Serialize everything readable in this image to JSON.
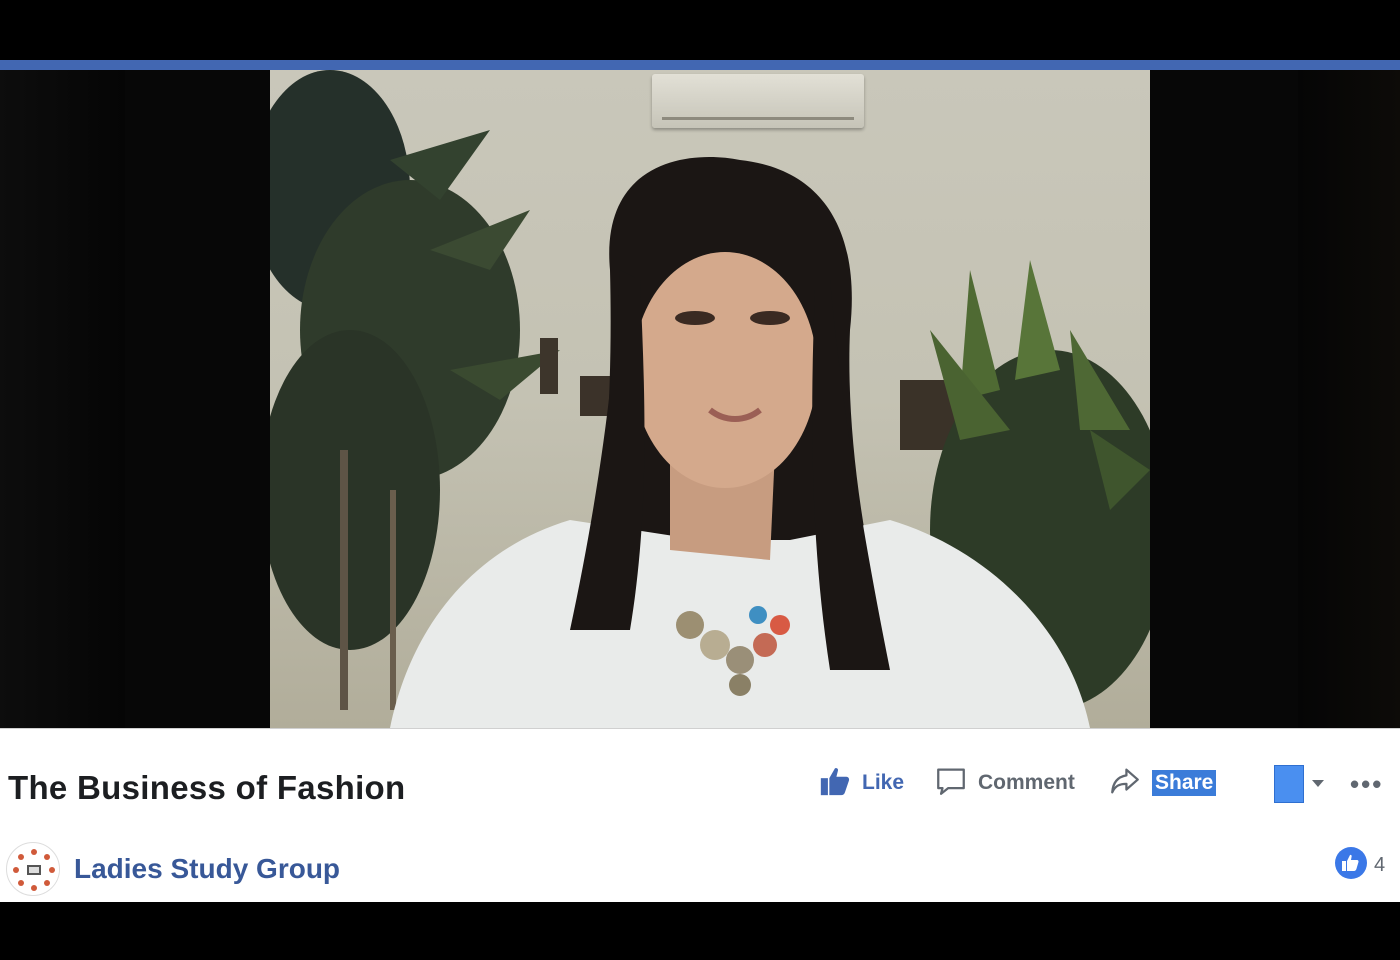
{
  "video": {
    "title": "The Business of Fashion"
  },
  "actions": {
    "like_label": "Like",
    "comment_label": "Comment",
    "share_label": "Share"
  },
  "page": {
    "name": "Ladies Study Group"
  },
  "reactions": {
    "count": "4"
  },
  "colors": {
    "accent_blue": "#4267b2",
    "page_link": "#385898",
    "share_highlight": "#3b7cd9"
  },
  "icons": {
    "like": "thumbs-up-icon",
    "comment": "speech-bubble-icon",
    "share": "share-arrow-icon",
    "more": "ellipsis-icon",
    "caret": "caret-down-icon",
    "reaction": "like-reaction-icon"
  }
}
